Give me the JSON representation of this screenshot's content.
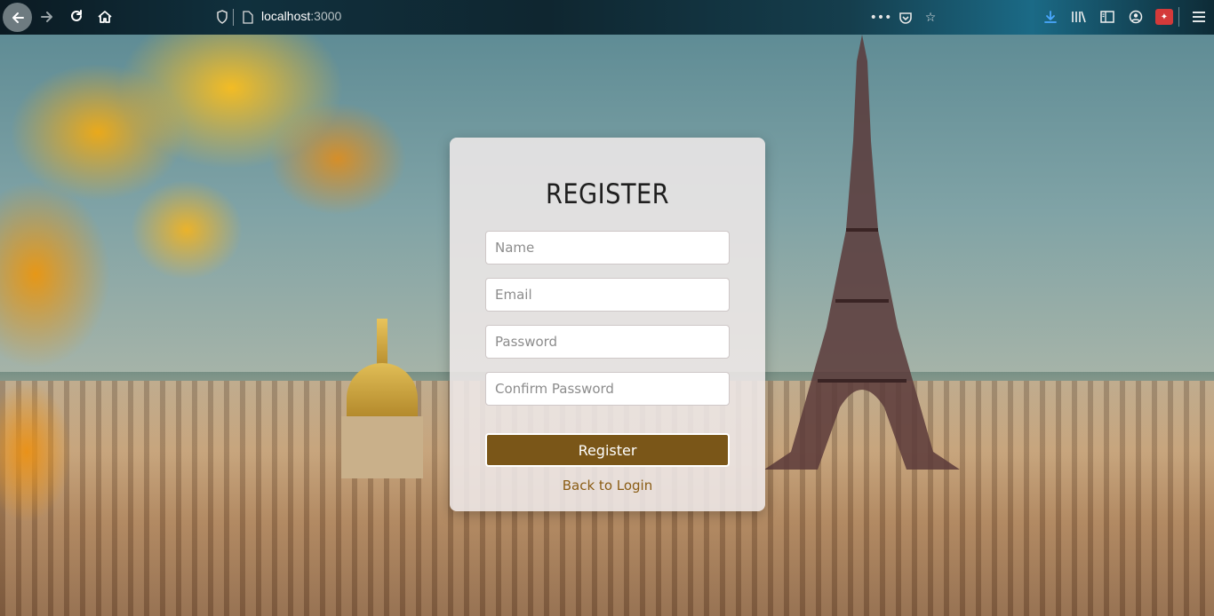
{
  "browser": {
    "url_host": "localhost",
    "url_port": ":3000",
    "icons": {
      "back": "back-arrow-icon",
      "forward": "forward-arrow-icon",
      "reload": "reload-icon",
      "home": "home-icon",
      "tracking_protection": "shield-icon",
      "page_info": "page-icon",
      "page_actions": "more-dots-icon",
      "pocket": "pocket-icon",
      "bookmark": "star-icon",
      "downloads": "download-icon",
      "library": "library-icon",
      "sidebar": "sidebar-icon",
      "account": "account-icon",
      "extension": "extension-icon",
      "menu": "hamburger-menu-icon"
    }
  },
  "register_form": {
    "title": "REGISTER",
    "name_placeholder": "Name",
    "email_placeholder": "Email",
    "password_placeholder": "Password",
    "confirm_password_placeholder": "Confirm Password",
    "submit_label": "Register",
    "login_link": "Back to Login"
  },
  "colors": {
    "button_bg": "#7a5618",
    "link_color": "#8a5c14",
    "card_bg": "rgba(238,232,232,0.88)"
  }
}
